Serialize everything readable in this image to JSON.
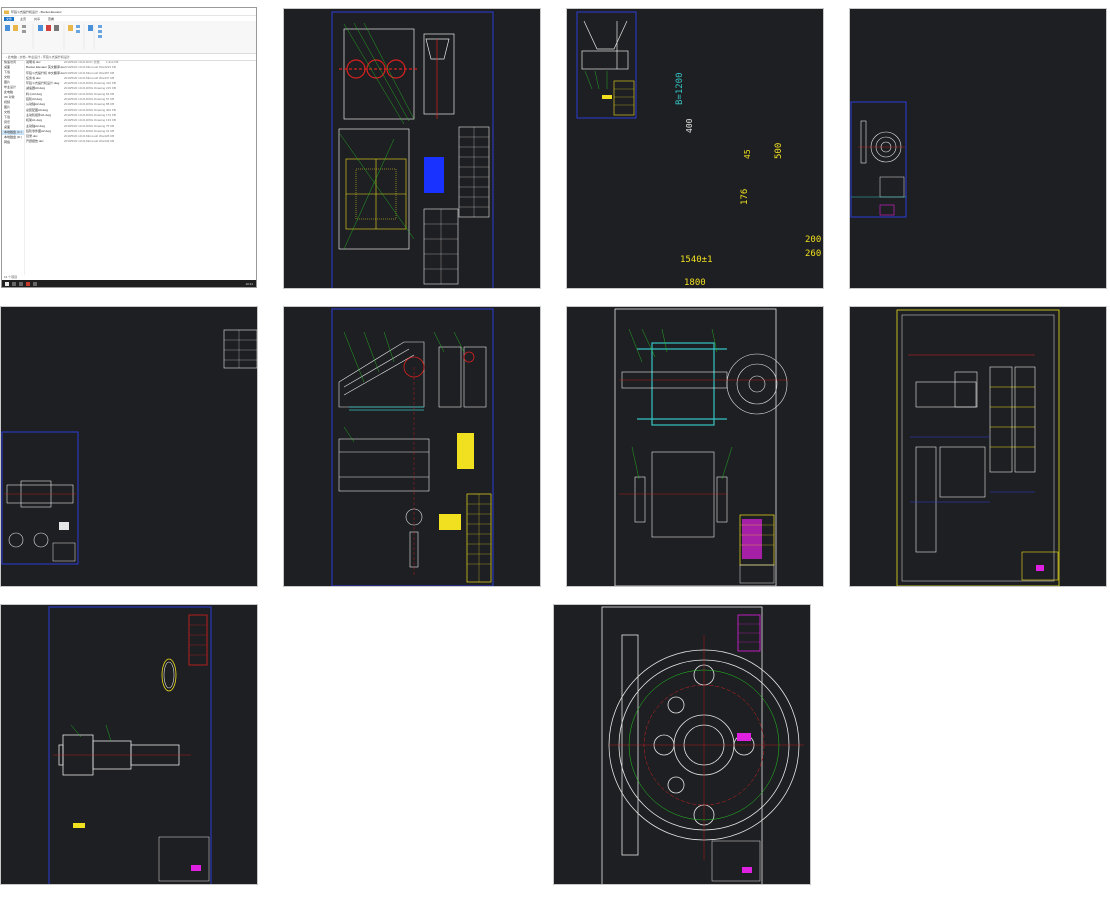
{
  "explorer": {
    "title": "环链斗式提升机设计 - Bucket Elevator",
    "tabs": [
      "文件",
      "主页",
      "共享",
      "查看"
    ],
    "address": "› 此电脑 › 文档 › 毕业设计 › 环链斗式提升机设计",
    "nav_items": [
      "快速访问",
      "桌面",
      "下载",
      "文档",
      "图片",
      "毕业设计",
      "此电脑",
      "3D 对象",
      "视频",
      "图片",
      "文档",
      "下载",
      "音乐",
      "桌面",
      "本地磁盘 (C:)",
      "本地磁盘 (D:)",
      "网络"
    ],
    "files": [
      {
        "name": "说明书.doc",
        "date": "2019/5/20 10:21",
        "type": "DOC 文档",
        "size": "1,912 KB"
      },
      {
        "name": "Bucket Elevator 英文翻译.doc",
        "date": "2019/5/20 10:21",
        "type": "Microsoft Word",
        "size": "215 KB"
      },
      {
        "name": "环链斗式提升机 中文翻译.doc",
        "date": "2019/5/20 10:21",
        "type": "Microsoft Word",
        "size": "57 KB"
      },
      {
        "name": "任务书.doc",
        "date": "2019/5/20 10:21",
        "type": "Microsoft Word",
        "size": "37 KB"
      },
      {
        "name": "环链斗式提升机设计.dwg",
        "date": "2019/5/20 10:21",
        "type": "DWG Drawing",
        "size": "310 KB"
      },
      {
        "name": "减速器A0.dwg",
        "date": "2019/5/20 10:21",
        "type": "DWG Drawing",
        "size": "215 KB"
      },
      {
        "name": "料斗A3.dwg",
        "date": "2019/5/20 10:21",
        "type": "DWG Drawing",
        "size": "64 KB"
      },
      {
        "name": "链轮A3.dwg",
        "date": "2019/5/20 10:21",
        "type": "DWG Drawing",
        "size": "57 KB"
      },
      {
        "name": "从动轴A2.dwg",
        "date": "2019/5/20 10:21",
        "type": "DWG Drawing",
        "size": "88 KB"
      },
      {
        "name": "总装配图A0.dwg",
        "date": "2019/5/20 10:21",
        "type": "DWG Drawing",
        "size": "402 KB"
      },
      {
        "name": "主动轮组件A1.dwg",
        "date": "2019/5/20 10:21",
        "type": "DWG Drawing",
        "size": "176 KB"
      },
      {
        "name": "机架A1.dwg",
        "date": "2019/5/20 10:21",
        "type": "DWG Drawing",
        "size": "133 KB"
      },
      {
        "name": "主动轴A2.dwg",
        "date": "2019/5/20 10:21",
        "type": "DWG Drawing",
        "size": "75 KB"
      },
      {
        "name": "链轮零件图A2.dwg",
        "date": "2019/5/20 10:21",
        "type": "DWG Drawing",
        "size": "91 KB"
      },
      {
        "name": "目录.doc",
        "date": "2019/5/20 10:21",
        "type": "Microsoft Word",
        "size": "26 KB"
      },
      {
        "name": "开题报告.doc",
        "date": "2019/5/20 10:21",
        "type": "Microsoft Word",
        "size": "42 KB"
      }
    ],
    "status": "16 个项目",
    "clock": "10:21"
  },
  "hopper_dims": {
    "d1": "B=1200",
    "d2": "400",
    "d3": "45",
    "d4": "500",
    "d5": "176",
    "d6": "1540±1",
    "d7": "1800",
    "d8": "200",
    "d9": "260"
  },
  "colors": {
    "background": "#1e1f22",
    "frame": "#2c3cd8",
    "line": "#e6e6e6",
    "leader": "#22cc22",
    "center": "#d82020",
    "yellow": "#f0e020",
    "cyan": "#34c4c4",
    "magenta": "#e020e0",
    "blue_block": "#1a32ff"
  }
}
